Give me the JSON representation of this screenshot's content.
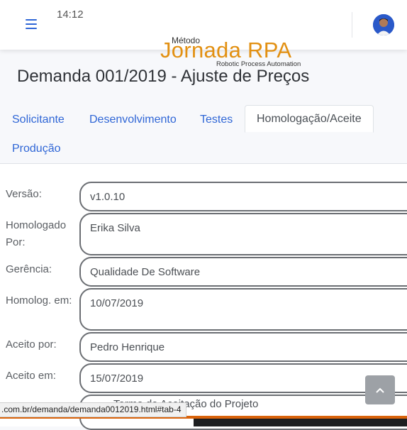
{
  "header": {
    "time": "14:12",
    "logo": {
      "top": "Método",
      "main": "Jornada RPA",
      "tagline": "Robotic Process Automation"
    }
  },
  "page": {
    "title": "Demanda 001/2019 - Ajuste de Preços"
  },
  "tabs": [
    {
      "label": "Solicitante"
    },
    {
      "label": "Desenvolvimento"
    },
    {
      "label": "Testes"
    },
    {
      "label": "Homologação/Aceite",
      "active": true
    },
    {
      "label": "Produção"
    }
  ],
  "form": {
    "fields": [
      {
        "label": "Versão:",
        "value": "v1.0.10"
      },
      {
        "label": "Homologado Por:",
        "value": "Erika Silva"
      },
      {
        "label": "Gerência:",
        "value": "Qualidade De Software"
      },
      {
        "label": "Homolog. em:",
        "value": "10/07/2019"
      },
      {
        "label": "Aceito por:",
        "value": "Pedro Henrique"
      },
      {
        "label": "Aceito em:",
        "value": "15/07/2019"
      },
      {
        "label": "",
        "value": "Termo de Aceitação do Projeto"
      }
    ]
  },
  "status_bar": {
    "url": ".com.br/demanda/demanda0012019.html#tab-4"
  },
  "colors": {
    "accent": "#2f66d6",
    "brand": "#e29012",
    "field_border": "#6b6e73"
  },
  "icons": {
    "menu": "hamburger-icon",
    "back_to_top": "chevron-up-icon"
  }
}
